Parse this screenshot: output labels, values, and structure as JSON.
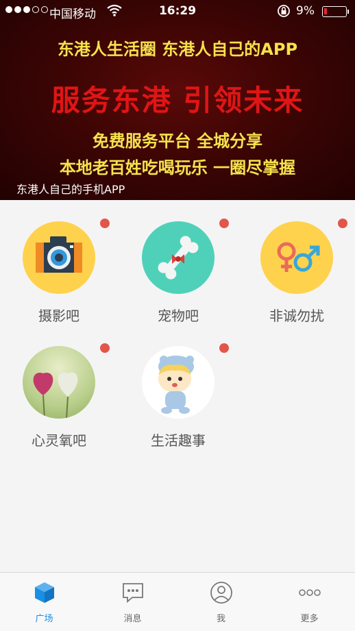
{
  "status_bar": {
    "carrier": "中国移动",
    "time": "16:29",
    "battery": "9%"
  },
  "banner": {
    "line1": "东港人生活圈  东港人自己的APP",
    "line2": "服务东港  引领未来",
    "line3": "免费服务平台  全城分享",
    "line4": "本地老百姓吃喝玩乐  一圈尽掌握",
    "caption": "东港人自己的手机APP"
  },
  "categories": [
    {
      "label": "摄影吧",
      "icon": "camera-icon",
      "bg": "#ffd24d"
    },
    {
      "label": "宠物吧",
      "icon": "bone-icon",
      "bg": "#4fd1b9"
    },
    {
      "label": "非诚勿扰",
      "icon": "gender-icon",
      "bg": "#ffd24d"
    },
    {
      "label": "心灵氧吧",
      "icon": "hearts-icon",
      "bg": "#c9d8a0"
    },
    {
      "label": "生活趣事",
      "icon": "cartoon-baby-icon",
      "bg": "#ffffff"
    }
  ],
  "tabs": [
    {
      "label": "广场",
      "icon": "cube-icon"
    },
    {
      "label": "消息",
      "icon": "message-icon"
    },
    {
      "label": "我",
      "icon": "user-icon"
    },
    {
      "label": "更多",
      "icon": "more-icon"
    }
  ],
  "colors": {
    "accent": "#1a8fe3",
    "badge": "#e2564a",
    "banner_text": "#f6e24d",
    "banner_title": "#e01515"
  }
}
